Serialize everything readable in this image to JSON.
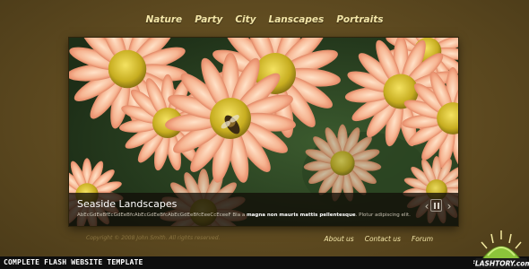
{
  "nav": {
    "items": [
      {
        "label": "Nature"
      },
      {
        "label": "Party"
      },
      {
        "label": "City"
      },
      {
        "label": "Lanscapes"
      },
      {
        "label": "Portraits"
      }
    ]
  },
  "slideshow": {
    "caption_title": "Seaside Landscapes",
    "caption_text_start": "AbEcGdEeBfEcGdEeBfcAbEcGdEeBfcAbEcGdEeBfcEeeCcEceeF Bla a ",
    "caption_text_bold": "magna non mauris mattis pellentesque",
    "caption_text_end": ". Plotur adipiscing elit.",
    "controls": {
      "prev_icon": "chevron-left-icon",
      "pause_icon": "pause-icon",
      "next_icon": "chevron-right-icon"
    }
  },
  "footer": {
    "copyright": "Copyright © 2008 John Smith. All rights reserved.",
    "links": [
      {
        "label": "About us"
      },
      {
        "label": "Contact us"
      },
      {
        "label": "Forum"
      }
    ]
  },
  "banner": {
    "title": "COMPLETE FLASH WEBSITE TEMPLATE",
    "brand": "FLASHTORY.com"
  },
  "colors": {
    "background": "#5e4a20",
    "nav_text": "#f3e6a8",
    "caption_bar": "#120e08",
    "copyright_text": "#8a7441",
    "banner_strip": "#0e0e0e",
    "logo_green": "#8cc43a"
  }
}
